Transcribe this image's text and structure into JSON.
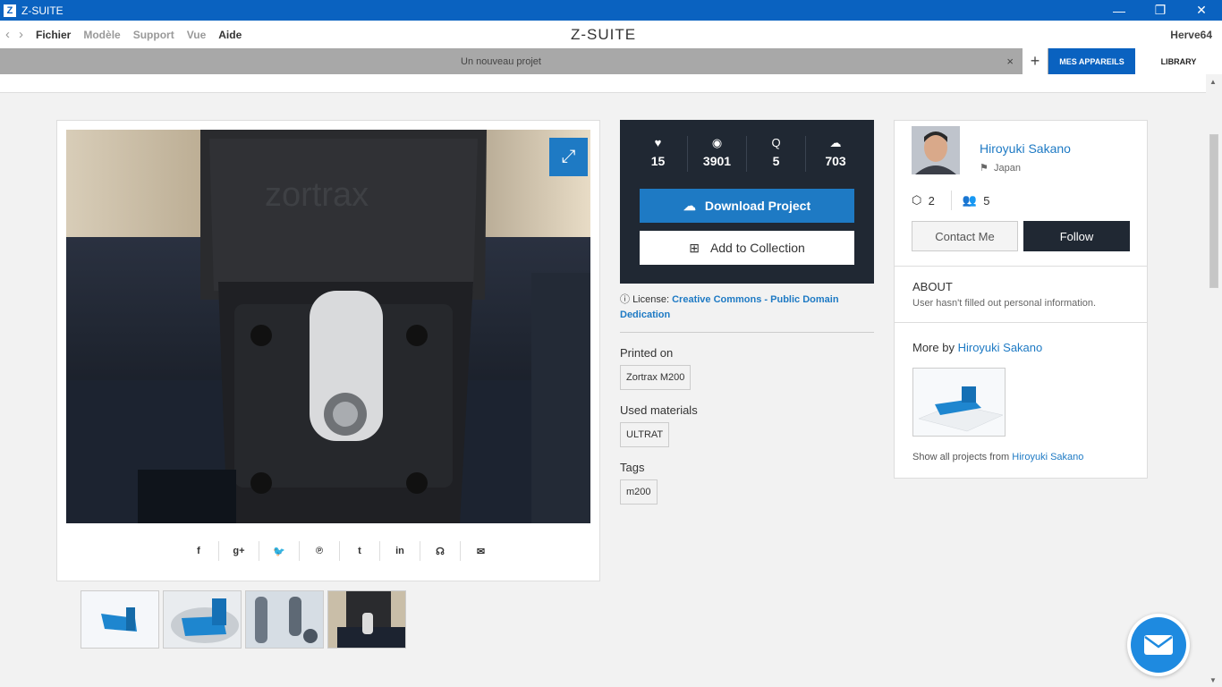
{
  "window": {
    "app_icon": "Z",
    "title": "Z-SUITE",
    "minimize": "—",
    "restore": "❐",
    "close": "✕"
  },
  "menubar": {
    "back": "‹",
    "forward": "›",
    "items": [
      "Fichier",
      "Modèle",
      "Support",
      "Vue",
      "Aide"
    ],
    "brand": "Z-SUITE",
    "user": "Herve64"
  },
  "tabs": {
    "project_tab": "Un nouveau projet",
    "close": "×",
    "add": "+",
    "devices": "MES APPAREILS",
    "library": "LIBRARY"
  },
  "image_card": {
    "expand_icon": "arrows-expand-icon",
    "share": [
      "f",
      "g+",
      "t-bird",
      "p",
      "t",
      "in",
      "reddit",
      "mail"
    ],
    "share_labels": [
      "f",
      "g+",
      "🐦",
      "℗",
      "t",
      "in",
      "☊",
      "✉"
    ],
    "photo_text": "zortrax"
  },
  "stats": {
    "likes": "15",
    "views": "3901",
    "comments": "5",
    "downloads": "703",
    "download_label": "Download Project",
    "collection_label": "Add to Collection"
  },
  "license": {
    "prefix": "License:",
    "link": "Creative Commons - Public Domain Dedication"
  },
  "details": {
    "printed_on_title": "Printed on",
    "printer": "Zortrax M200",
    "materials_title": "Used materials",
    "material": "ULTRAT",
    "tags_title": "Tags",
    "tag": "m200"
  },
  "author": {
    "name": "Hiroyuki Sakano",
    "country": "Japan",
    "models": "2",
    "followers": "5",
    "contact": "Contact Me",
    "follow": "Follow",
    "about_title": "ABOUT",
    "about_text": "User hasn't filled out personal information.",
    "more_by": "More by",
    "show_all": "Show all projects from"
  },
  "colors": {
    "accent": "#1e7ac4",
    "titlebar": "#0a62c0",
    "dark": "#202833"
  }
}
